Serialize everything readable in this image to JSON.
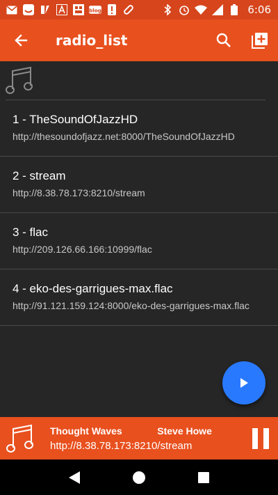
{
  "status_bar": {
    "time": "6:06",
    "left_icons": [
      "mail-icon",
      "messenger-icon",
      "flash-icon",
      "font-icon",
      "news-icon",
      "blog-icon",
      "alert-icon",
      "pill-icon"
    ],
    "right_icons": [
      "bluetooth-icon",
      "alarm-icon",
      "wifi-icon",
      "signal-icon",
      "battery-icon"
    ]
  },
  "toolbar": {
    "title": "radio_list",
    "back_icon": "arrow-back-icon",
    "search_icon": "search-icon",
    "add_icon": "add-playlist-icon"
  },
  "stations": [
    {
      "title": "1 - TheSoundOfJazzHD",
      "url": "http://thesoundofjazz.net:8000/TheSoundOfJazzHD"
    },
    {
      "title": "2 - stream",
      "url": "http://8.38.78.173:8210/stream"
    },
    {
      "title": "3 - flac",
      "url": "http://209.126.66.166:10999/flac"
    },
    {
      "title": "4 - eko-des-garrigues-max.flac",
      "url": "http://91.121.159.124:8000/eko-des-garrigues-max.flac"
    }
  ],
  "now_playing": {
    "track": "Thought Waves             Steve Howe",
    "url": "http://8.38.78.173:8210/stream"
  },
  "colors": {
    "primary": "#e8501e",
    "status_bar": "#d6451c",
    "background": "#262626",
    "fab": "#2979ff"
  }
}
